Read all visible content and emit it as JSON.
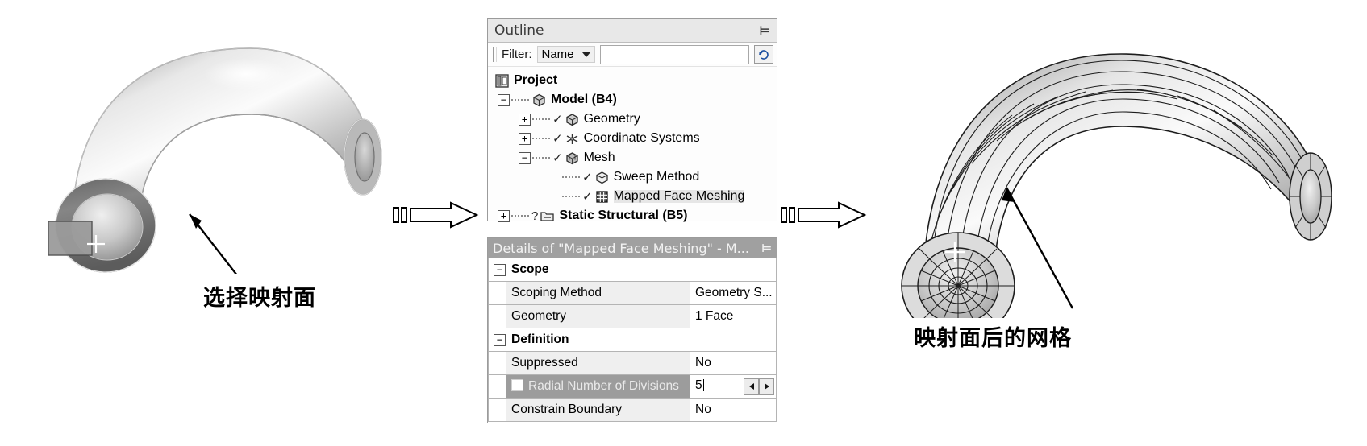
{
  "figure": {
    "left_caption": "选择映射面",
    "right_caption": "映射面后的网格"
  },
  "outline": {
    "title": "Outline",
    "pin_icon": "pin-icon",
    "pin_glyph": "⊨",
    "filter": {
      "label": "Filter:",
      "selected": "Name",
      "input_value": "",
      "input_placeholder": "",
      "refresh_icon": "refresh-icon"
    },
    "tree": [
      {
        "indent": 0,
        "expander": "",
        "check": "",
        "icon": "project-icon",
        "label": "Project",
        "bold": true,
        "selected": false
      },
      {
        "indent": 1,
        "expander": "−",
        "check": "",
        "icon": "model-icon",
        "label": "Model (B4)",
        "bold": true,
        "selected": false
      },
      {
        "indent": 2,
        "expander": "+",
        "check": "✓",
        "icon": "geometry-icon",
        "label": "Geometry",
        "bold": false,
        "selected": false
      },
      {
        "indent": 2,
        "expander": "+",
        "check": "✓",
        "icon": "coordinate-systems-icon",
        "label": "Coordinate Systems",
        "bold": false,
        "selected": false
      },
      {
        "indent": 2,
        "expander": "−",
        "check": "✓",
        "icon": "mesh-icon",
        "label": "Mesh",
        "bold": false,
        "selected": false
      },
      {
        "indent": 3,
        "expander": "",
        "check": "✓",
        "icon": "sweep-method-icon",
        "label": "Sweep Method",
        "bold": false,
        "selected": false
      },
      {
        "indent": 3,
        "expander": "",
        "check": "✓",
        "icon": "mapped-face-mesh-icon",
        "label": "Mapped Face Meshing",
        "bold": false,
        "selected": true
      },
      {
        "indent": 1,
        "expander": "+",
        "check": "?",
        "icon": "static-structural-icon",
        "label": "Static Structural (B5)",
        "bold": true,
        "selected": false
      }
    ]
  },
  "details": {
    "title": "Details of \"Mapped Face Meshing\" - M...",
    "pin_glyph": "⊨",
    "rows": [
      {
        "type": "group",
        "expander": "−",
        "key": "Scope",
        "value": ""
      },
      {
        "type": "item",
        "expander": "",
        "key": "Scoping Method",
        "value": "Geometry S...",
        "selected": false
      },
      {
        "type": "item",
        "expander": "",
        "key": "Geometry",
        "value": "1 Face",
        "selected": false
      },
      {
        "type": "group",
        "expander": "−",
        "key": "Definition",
        "value": ""
      },
      {
        "type": "item",
        "expander": "",
        "key": "Suppressed",
        "value": "No",
        "selected": false
      },
      {
        "type": "spin",
        "expander": "",
        "key": "Radial Number of Divisions",
        "value": "5",
        "selected": true,
        "checkbox": true,
        "left_arrow": "◄",
        "right_arrow": "►"
      },
      {
        "type": "item",
        "expander": "",
        "key": "Constrain Boundary",
        "value": "No",
        "selected": false
      }
    ]
  },
  "connectors": [
    {
      "name": "arrow-left-to-outline"
    },
    {
      "name": "arrow-outline-to-mesh"
    }
  ],
  "models": {
    "left": {
      "name": "pipe-elbow-smooth-model",
      "crosshair": "+"
    },
    "right": {
      "name": "pipe-elbow-meshed-model",
      "crosshair": "+"
    }
  }
}
